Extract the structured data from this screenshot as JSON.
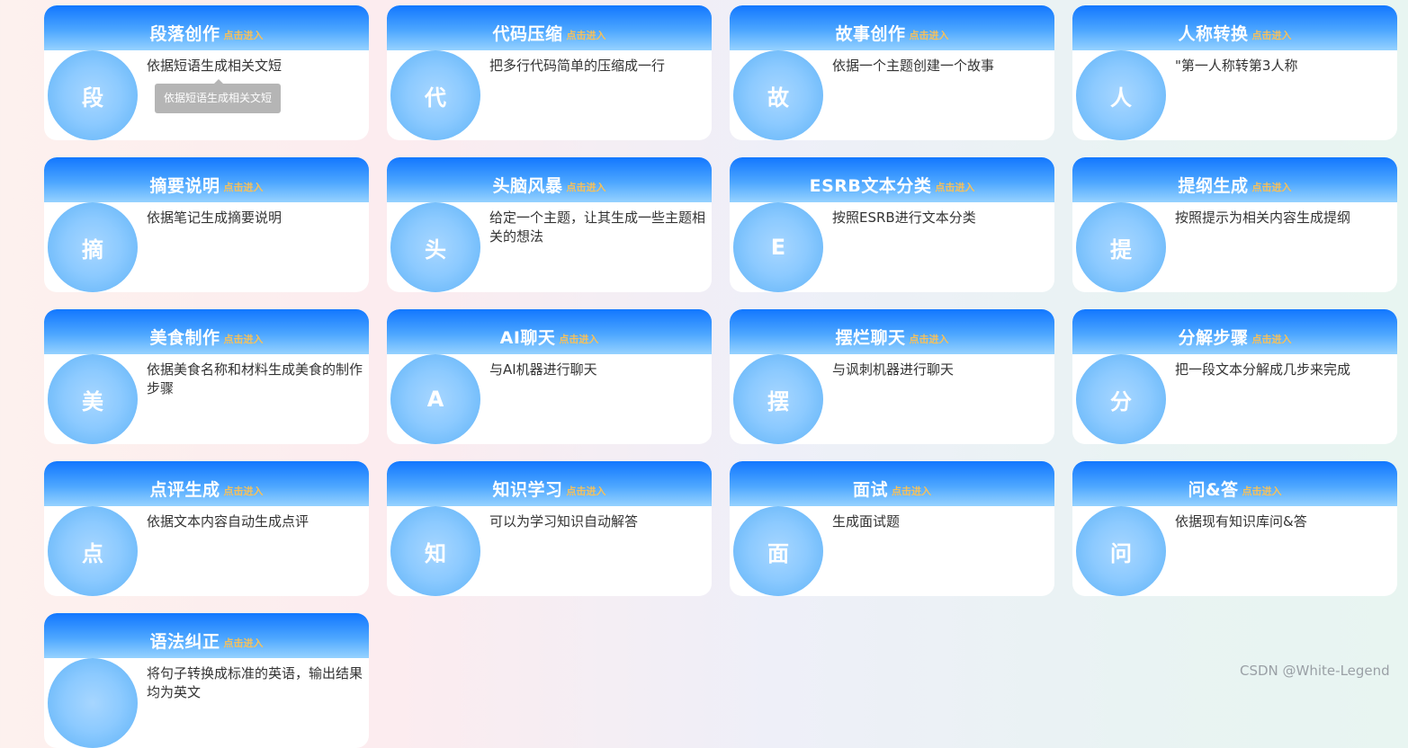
{
  "enter_label": "点击进入",
  "cards": [
    {
      "title": "段落创作",
      "letter": "段",
      "desc": "依据短语生成相关文短"
    },
    {
      "title": "代码压缩",
      "letter": "代",
      "desc": "把多行代码简单的压缩成一行"
    },
    {
      "title": "故事创作",
      "letter": "故",
      "desc": "依据一个主题创建一个故事"
    },
    {
      "title": "人称转换",
      "letter": "人",
      "desc": "\"第一人称转第3人称"
    },
    {
      "title": "摘要说明",
      "letter": "摘",
      "desc": "依据笔记生成摘要说明"
    },
    {
      "title": "头脑风暴",
      "letter": "头",
      "desc": "给定一个主题，让其生成一些主题相关的想法"
    },
    {
      "title": "ESRB文本分类",
      "letter": "E",
      "desc": "按照ESRB进行文本分类"
    },
    {
      "title": "提纲生成",
      "letter": "提",
      "desc": "按照提示为相关内容生成提纲"
    },
    {
      "title": "美食制作",
      "letter": "美",
      "desc": "依据美食名称和材料生成美食的制作步骤"
    },
    {
      "title": "AI聊天",
      "letter": "A",
      "desc": "与AI机器进行聊天"
    },
    {
      "title": "摆烂聊天",
      "letter": "摆",
      "desc": "与讽刺机器进行聊天"
    },
    {
      "title": "分解步骤",
      "letter": "分",
      "desc": "把一段文本分解成几步来完成"
    },
    {
      "title": "点评生成",
      "letter": "点",
      "desc": "依据文本内容自动生成点评"
    },
    {
      "title": "知识学习",
      "letter": "知",
      "desc": "可以为学习知识自动解答"
    },
    {
      "title": "面试",
      "letter": "面",
      "desc": "生成面试题"
    },
    {
      "title": "问&答",
      "letter": "问",
      "desc": "依据现有知识库问&答"
    },
    {
      "title": "语法纠正",
      "letter": "",
      "desc": "将句子转换成标准的英语，输出结果均为英文"
    }
  ],
  "tooltip": "依据短语生成相关文短",
  "watermark": "CSDN @White-Legend"
}
